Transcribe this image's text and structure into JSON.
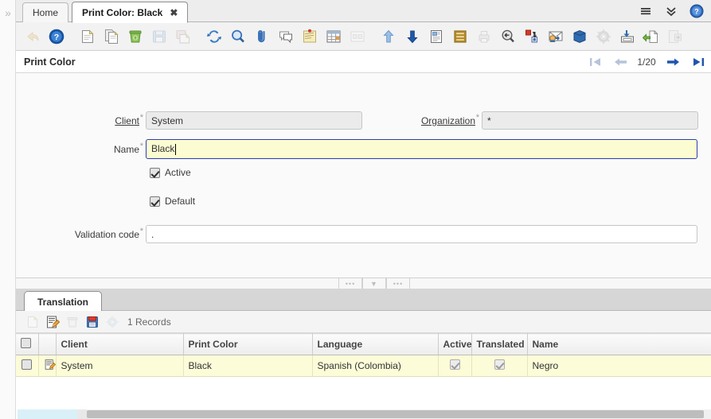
{
  "window": {
    "tabs": [
      {
        "label": "Home",
        "active": false,
        "closable": false
      },
      {
        "label": "Print Color: Black",
        "active": true,
        "closable": true,
        "close_glyph": "✖"
      }
    ],
    "rail_expand_glyph": "»",
    "right_icons": [
      {
        "name": "menu-icon",
        "glyph": "☰"
      },
      {
        "name": "chevron-double-down-icon",
        "glyph": "»"
      },
      {
        "name": "help-icon",
        "glyph": "?"
      }
    ]
  },
  "toolbar": {
    "items": [
      {
        "name": "undo-icon",
        "title": "Undo",
        "disabled": true
      },
      {
        "name": "help-icon",
        "title": "Help",
        "disabled": false
      },
      {
        "name": "new-record-icon",
        "title": "New Record",
        "disabled": false
      },
      {
        "name": "copy-record-icon",
        "title": "Copy Record",
        "disabled": false
      },
      {
        "name": "delete-record-icon",
        "title": "Delete Record",
        "disabled": false
      },
      {
        "name": "save-icon",
        "title": "Save Changes",
        "disabled": true
      },
      {
        "name": "save-create-icon",
        "title": "Save and Create New",
        "disabled": true
      },
      {
        "name": "refresh-icon",
        "title": "Refresh",
        "disabled": false
      },
      {
        "name": "find-icon",
        "title": "Find",
        "disabled": false
      },
      {
        "name": "attachment-icon",
        "title": "Attachment",
        "disabled": false
      },
      {
        "name": "chat-icon",
        "title": "Chat",
        "disabled": false
      },
      {
        "name": "note-icon",
        "title": "Post-It Note",
        "disabled": false
      },
      {
        "name": "grid-toggle-icon",
        "title": "Grid Toggle",
        "disabled": false
      },
      {
        "name": "multi-view-icon",
        "title": "Multi View",
        "disabled": true
      },
      {
        "name": "parent-record-icon",
        "title": "Parent Record",
        "disabled": false
      },
      {
        "name": "detail-record-icon",
        "title": "Detail Record",
        "disabled": false
      },
      {
        "name": "report-icon",
        "title": "Report",
        "disabled": false
      },
      {
        "name": "archive-icon",
        "title": "Archived Documents",
        "disabled": false
      },
      {
        "name": "print-icon",
        "title": "Print",
        "disabled": true
      },
      {
        "name": "print-preview-icon",
        "title": "Print Preview",
        "disabled": false
      },
      {
        "name": "zoom-across-icon",
        "title": "Zoom Across",
        "disabled": false
      },
      {
        "name": "request-icon",
        "title": "Requests",
        "disabled": false
      },
      {
        "name": "product-info-icon",
        "title": "Product Info",
        "disabled": false
      },
      {
        "name": "process-icon",
        "title": "Process",
        "disabled": true
      },
      {
        "name": "export-icon",
        "title": "Export",
        "disabled": false
      },
      {
        "name": "import-icon",
        "title": "Import",
        "disabled": false
      },
      {
        "name": "exit-icon",
        "title": "Exit",
        "disabled": true
      }
    ]
  },
  "header": {
    "title": "Print Color",
    "nav": {
      "first": {
        "name": "first-record-button",
        "glyph": "⏮",
        "disabled": true
      },
      "prev": {
        "name": "previous-record-button",
        "glyph": "←",
        "disabled": true
      },
      "position": "1/20",
      "next": {
        "name": "next-record-button",
        "glyph": "→",
        "disabled": false
      },
      "last": {
        "name": "last-record-button",
        "glyph": "⏭",
        "disabled": false
      }
    }
  },
  "form": {
    "fields": {
      "client": {
        "label": "Client",
        "required_mark": "*",
        "value": "System",
        "state": "readonly",
        "is_link": true
      },
      "organization": {
        "label": "Organization",
        "required_mark": "*",
        "value": "*",
        "state": "readonly",
        "is_link": true
      },
      "name": {
        "label": "Name",
        "required_mark": "*",
        "value": "Black",
        "state": "focused",
        "is_link": false
      },
      "validation_code": {
        "label": "Validation code",
        "required_mark": "*",
        "value": ".",
        "state": "editable",
        "is_link": false
      }
    },
    "checkboxes": [
      {
        "label": "Active",
        "checked": true
      },
      {
        "label": "Default",
        "checked": true
      }
    ]
  },
  "splitter": {
    "handles": [
      {
        "name": "splitter-handle-left",
        "glyph": "•••"
      },
      {
        "name": "splitter-collapse-handle",
        "glyph": "▼"
      },
      {
        "name": "splitter-handle-right",
        "glyph": "•••"
      }
    ]
  },
  "detail": {
    "tab_label": "Translation",
    "toolbar": [
      {
        "name": "new-record-icon",
        "title": "New",
        "disabled": true
      },
      {
        "name": "edit-record-icon",
        "title": "Edit",
        "disabled": false
      },
      {
        "name": "delete-record-icon",
        "title": "Delete",
        "disabled": true
      },
      {
        "name": "save-icon",
        "title": "Save",
        "disabled": false
      },
      {
        "name": "process-icon",
        "title": "Process",
        "disabled": true
      }
    ],
    "record_count": "1 Records",
    "grid": {
      "columns": [
        {
          "label": "",
          "key": "select",
          "align": "center"
        },
        {
          "label": "",
          "key": "edit",
          "align": "center"
        },
        {
          "label": "Client",
          "key": "client",
          "align": "left"
        },
        {
          "label": "Print Color",
          "key": "print_color",
          "align": "left"
        },
        {
          "label": "Language",
          "key": "language",
          "align": "left"
        },
        {
          "label": "Active",
          "key": "active",
          "align": "center"
        },
        {
          "label": "Translated",
          "key": "translated",
          "align": "center"
        },
        {
          "label": "Name",
          "key": "name",
          "align": "left"
        }
      ],
      "rows": [
        {
          "selected": false,
          "client": "System",
          "print_color": "Black",
          "language": "Spanish (Colombia)",
          "active": true,
          "translated": true,
          "name": "Negro"
        }
      ]
    }
  },
  "colors": {
    "accent_blue": "#2b5fb8",
    "focus_field_bg": "#fcfcd2",
    "focus_field_border": "#2b3fb0",
    "row_highlight": "#fcfcd8",
    "toolbar_bg": "#f2f2f2",
    "status_blue": "#d9f0f8"
  }
}
